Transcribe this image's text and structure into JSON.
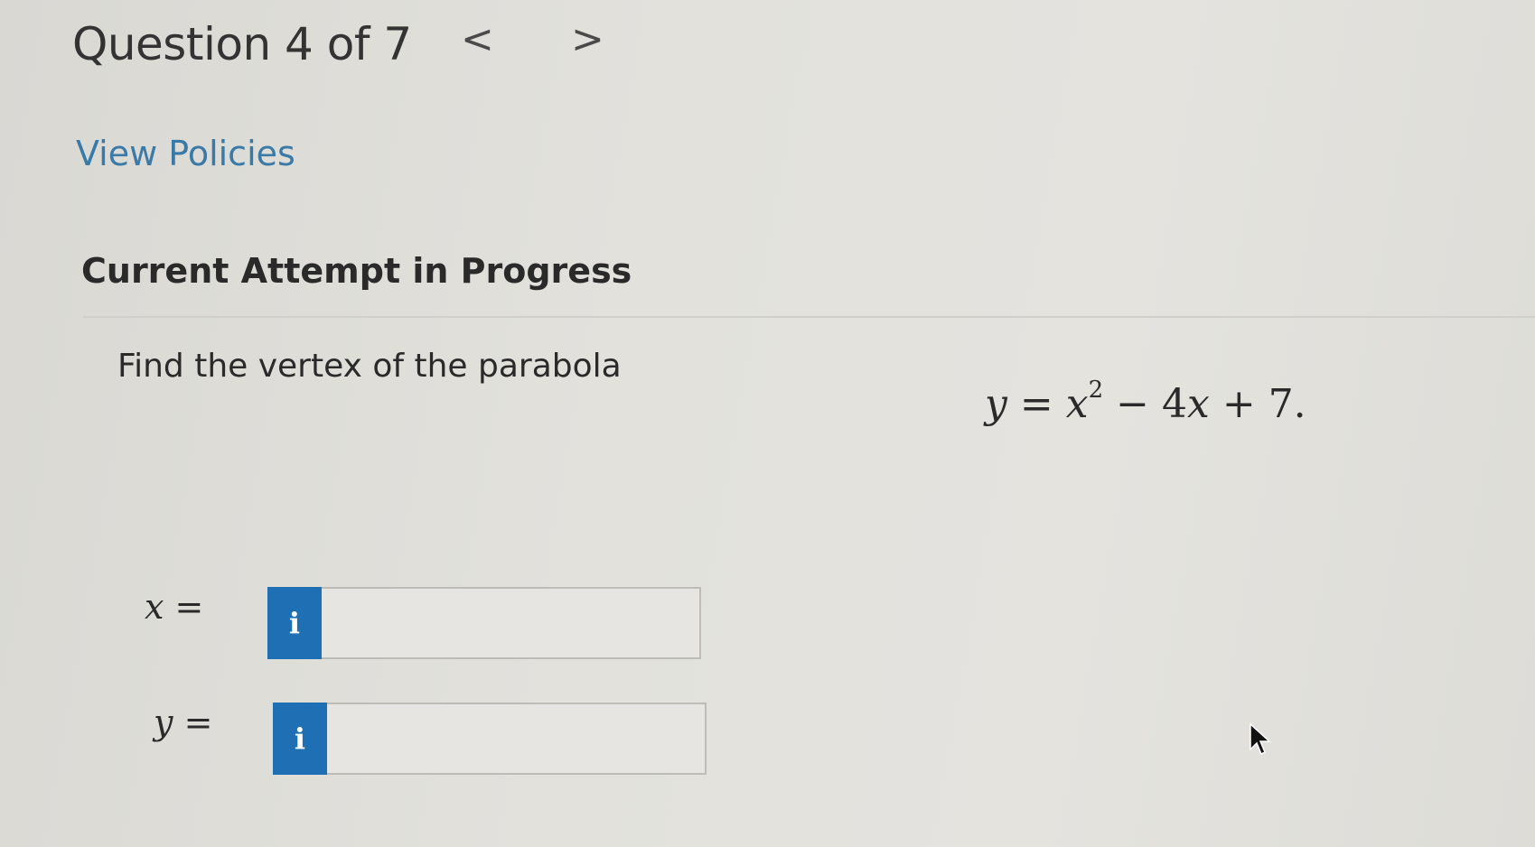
{
  "header": {
    "question_title": "Question 4 of 7",
    "prev_arrow": "<",
    "next_arrow": ">"
  },
  "links": {
    "view_policies": "View Policies"
  },
  "attempt": {
    "heading": "Current Attempt in Progress"
  },
  "question": {
    "prompt": "Find the vertex of the parabola",
    "equation": {
      "lhs": "y",
      "equals": "=",
      "term1_var": "x",
      "term1_exp": "2",
      "minus": "−",
      "term2_coef": "4",
      "term2_var": "x",
      "plus": "+",
      "constant": "7."
    }
  },
  "answers": [
    {
      "var": "x",
      "equals": "=",
      "info_label": "i",
      "value": ""
    },
    {
      "var": "y",
      "equals": "=",
      "info_label": "i",
      "value": ""
    }
  ],
  "colors": {
    "link": "#3a7aa8",
    "info_button": "#1f6fb5",
    "background": "#e2e1dc"
  }
}
